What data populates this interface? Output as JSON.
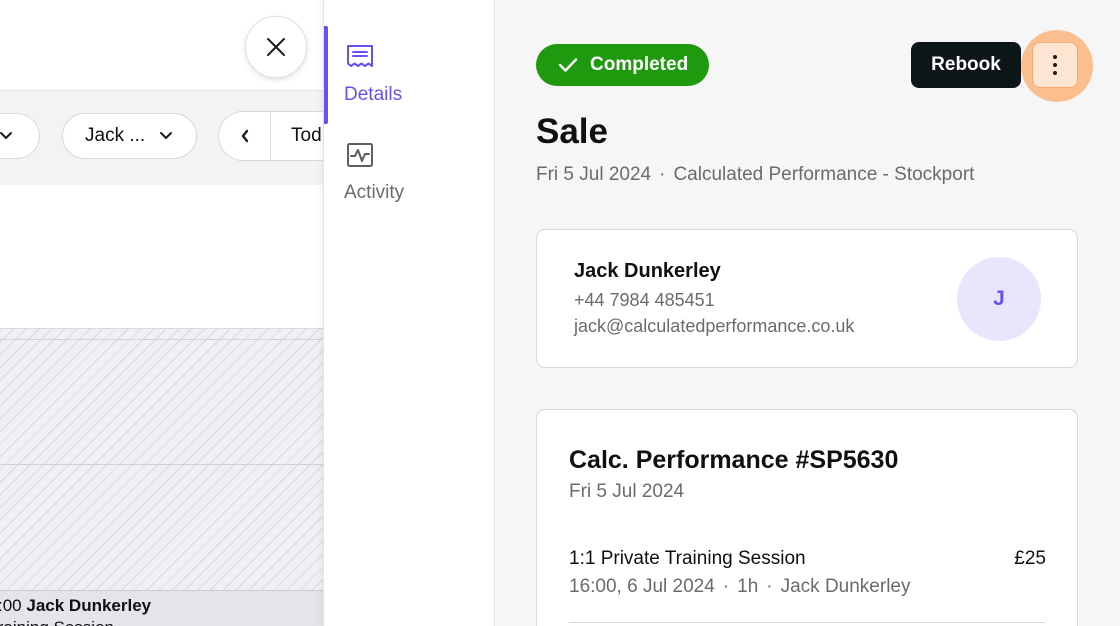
{
  "calendar": {
    "toolbar": {
      "left_dropdown_label": "",
      "staff_filter_label": "Jack ...",
      "today_label": "Tod"
    },
    "appointment": {
      "time_fragment": ":00",
      "client_name": "Jack Dunkerley",
      "service_fragment": "Training Session"
    }
  },
  "side_tabs": [
    {
      "label": "Details",
      "icon": "receipt-icon",
      "active": true
    },
    {
      "label": "Activity",
      "icon": "activity-icon",
      "active": false
    }
  ],
  "sale": {
    "status": "Completed",
    "status_color": "#1f9a0f",
    "rebook_label": "Rebook",
    "title": "Sale",
    "date": "Fri 5 Jul 2024",
    "location": "Calculated Performance - Stockport",
    "client": {
      "name": "Jack Dunkerley",
      "phone": "+44 7984 485451",
      "email": "jack@calculatedperformance.co.uk",
      "avatar_initial": "J"
    },
    "invoice": {
      "title": "Calc. Performance #SP5630",
      "date": "Fri 5 Jul 2024",
      "items": [
        {
          "name": "1:1 Private Training Session",
          "price": "£25",
          "time": "16:00, 6 Jul 2024",
          "duration": "1h",
          "staff": "Jack Dunkerley"
        }
      ]
    }
  },
  "accent_color": "#6950f3"
}
